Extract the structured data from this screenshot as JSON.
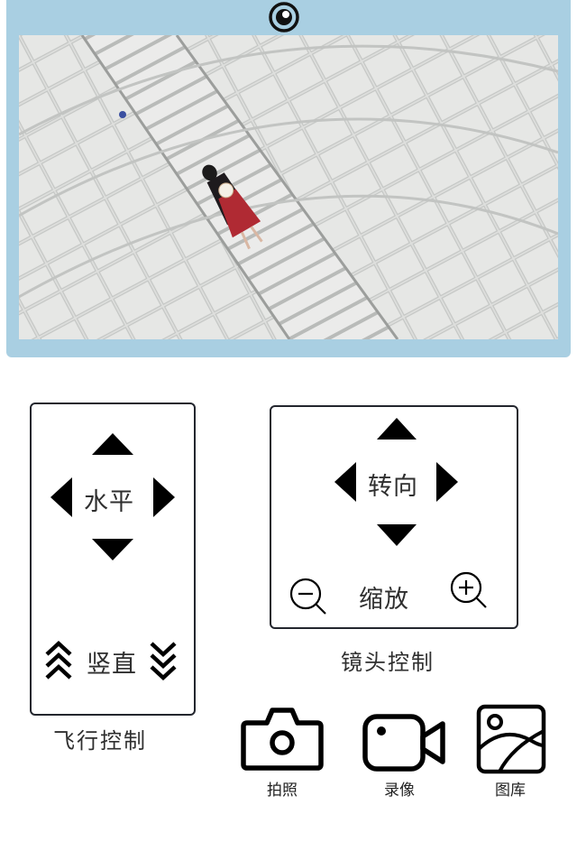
{
  "flight_control": {
    "horizontal_label": "水平",
    "vertical_label": "竖直",
    "caption": "飞行控制"
  },
  "lens_control": {
    "rotate_label": "转向",
    "zoom_label": "缩放",
    "caption": "镜头控制"
  },
  "actions": {
    "photo_label": "拍照",
    "record_label": "录像",
    "gallery_label": "图库"
  },
  "icons": {
    "top": "eye-icon",
    "photo": "camera-icon",
    "record": "video-camera-icon",
    "gallery": "gallery-icon",
    "zoom_out": "zoom-out-icon",
    "zoom_in": "zoom-in-icon"
  },
  "colors": {
    "frame": "#a9cfe2",
    "panel_border": "#23262e"
  }
}
